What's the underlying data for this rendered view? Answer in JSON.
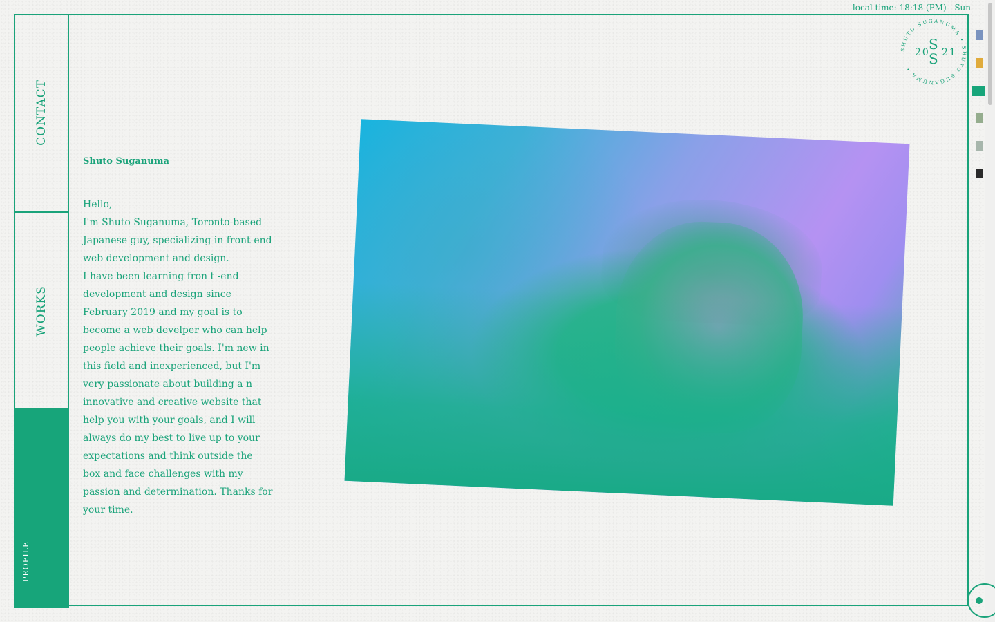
{
  "header": {
    "local_time": "local time: 18:18 (PM) - Sun"
  },
  "nav": {
    "contact_label": "CONTACT",
    "works_label": "WORKS",
    "profile_label": "PROFILE"
  },
  "profile": {
    "name": "Shuto Suganuma",
    "bio_lines": [
      "Hello,",
      "I'm Shuto Suganuma, Toronto-based Japanese guy, specializing in front-end web development and design.",
      "I have been learning fron t -end development and design since February 2019 and my goal is to become a web develper who can help people achieve their goals. I'm new in this field and inexperienced, but I'm very passionate about building a n  innovative and creative website that help you with your goals, and I will always do my best to live up to your expectations and think outside the box and face challenges with my passion and determination. Thanks for your time."
    ]
  },
  "logo": {
    "ring_text": "SHUTO SUGANUMA • SHUTO SUGANUMA •",
    "year_left": "20",
    "year_right": "21",
    "monogram_top": "S",
    "monogram_bottom": "S"
  },
  "theme_swatches": [
    {
      "name": "blue",
      "color": "#7a93bf"
    },
    {
      "name": "yellow",
      "color": "#e0ab3c"
    },
    {
      "name": "green",
      "color": "#17a57a"
    },
    {
      "name": "sage",
      "color": "#95ad8e"
    },
    {
      "name": "grey-green",
      "color": "#a7b6ac"
    },
    {
      "name": "black",
      "color": "#2a2a2a"
    }
  ],
  "colors": {
    "accent": "#17a57a",
    "background": "#f3f3f1"
  }
}
